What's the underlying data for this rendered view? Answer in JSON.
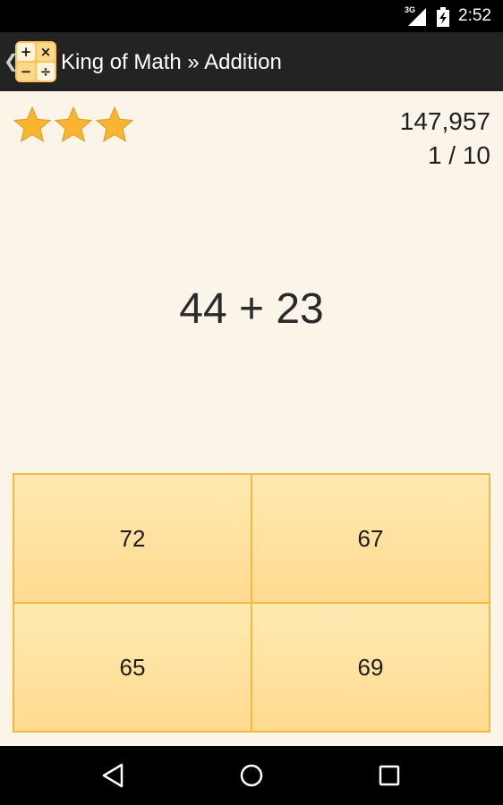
{
  "status_bar": {
    "network": "3G",
    "time": "2:52"
  },
  "action_bar": {
    "up_chevron": "❮",
    "app_icon_symbols": [
      "+",
      "×",
      "−",
      "÷"
    ],
    "title": "King of Math » Addition"
  },
  "game": {
    "stars": 3,
    "score": "147,957",
    "progress": "1 / 10",
    "question": "44 + 23",
    "answers": [
      "72",
      "67",
      "65",
      "69"
    ]
  },
  "colors": {
    "background": "#faf4e9",
    "star": "#f9b52f",
    "answer_fill": "#ffe2a0",
    "answer_border": "#f5b93d",
    "action_bar": "#232323"
  },
  "icons": {
    "status": [
      "signal-3g-icon",
      "battery-charging-icon"
    ],
    "nav": [
      "back-icon",
      "home-icon",
      "recents-icon"
    ],
    "rating": "star-icon"
  }
}
